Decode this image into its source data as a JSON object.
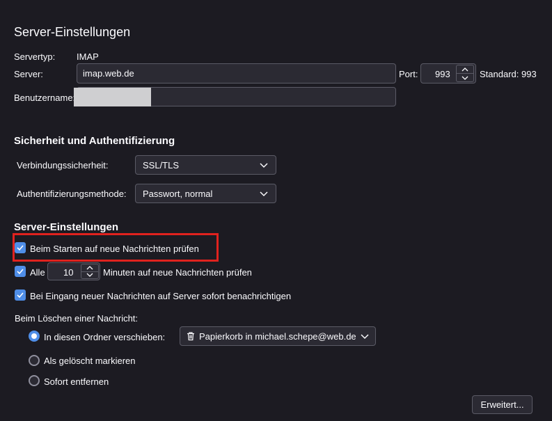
{
  "server": {
    "heading": "Server-Einstellungen",
    "type_label": "Servertyp:",
    "type_value": "IMAP",
    "server_label": "Server:",
    "server_value": "imap.web.de",
    "port_label": "Port:",
    "port_value": "993",
    "standard_label": "Standard: 993",
    "username_label": "Benutzername:",
    "username_value": ""
  },
  "security": {
    "heading": "Sicherheit und Authentifizierung",
    "connection_label": "Verbindungssicherheit:",
    "connection_value": "SSL/TLS",
    "auth_label": "Authentifizierungsmethode:",
    "auth_value": "Passwort, normal"
  },
  "server_settings": {
    "heading": "Server-Einstellungen",
    "check_on_start": {
      "label": "Beim Starten auf neue Nachrichten prüfen",
      "checked": true
    },
    "check_every": {
      "label_before": "Alle",
      "minutes": "10",
      "label_after": "Minuten auf neue Nachrichten prüfen",
      "checked": true
    },
    "notify_on_arrival": {
      "label": "Bei Eingang neuer Nachrichten auf Server sofort benachrichtigen",
      "checked": true
    }
  },
  "delete": {
    "heading": "Beim Löschen einer Nachricht:",
    "options": [
      {
        "label": "In diesen Ordner verschieben:",
        "selected": true
      },
      {
        "label": "Als gelöscht markieren",
        "selected": false
      },
      {
        "label": "Sofort entfernen",
        "selected": false
      }
    ],
    "folder_value": "Papierkorb in michael.schepe@web.de"
  },
  "advanced_button": "Erweitert...",
  "colors": {
    "background": "#1c1b22",
    "field": "#2b2a33",
    "accent": "#4f8ee8",
    "highlight": "#e0221e"
  },
  "icons": [
    "chevron-down-icon",
    "spin-up-icon",
    "spin-down-icon",
    "checkmark-icon",
    "trash-icon"
  ]
}
